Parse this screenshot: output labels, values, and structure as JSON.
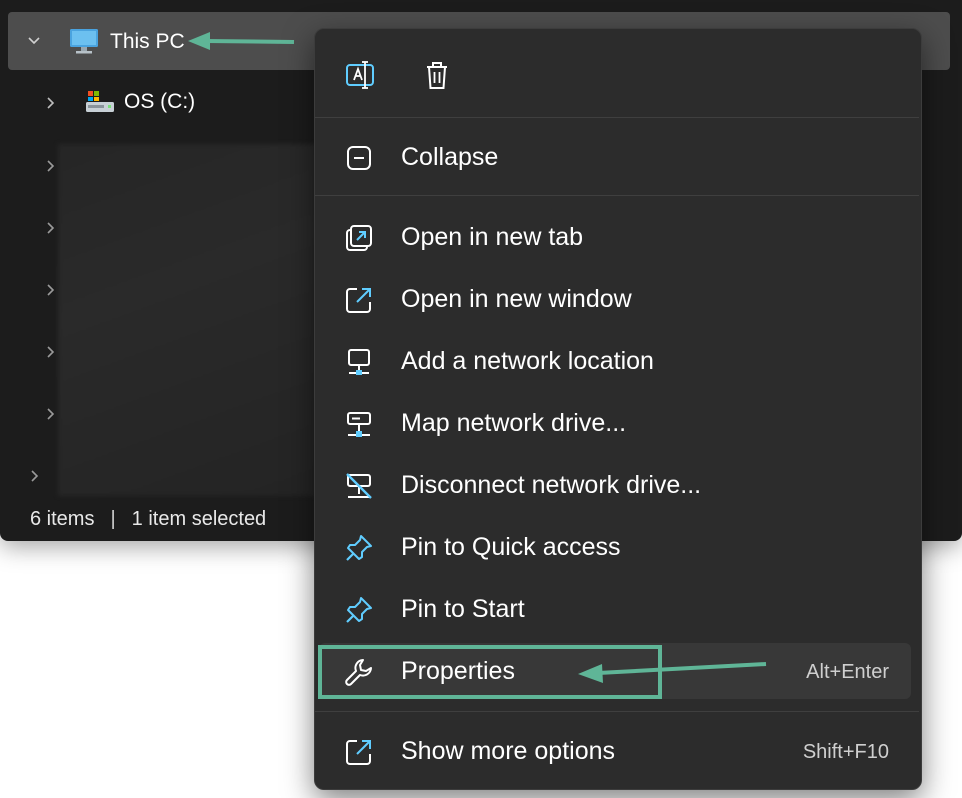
{
  "tree": {
    "this_pc": "This PC",
    "os_drive": "OS (C:)"
  },
  "status": {
    "items": "6 items",
    "selected": "1 item selected"
  },
  "menu": {
    "toolbar": [
      {
        "name": "rename-icon"
      },
      {
        "name": "delete-icon"
      }
    ],
    "collapse": "Collapse",
    "items": [
      {
        "label": "Open in new tab"
      },
      {
        "label": "Open in new window"
      },
      {
        "label": "Add a network location"
      },
      {
        "label": "Map network drive..."
      },
      {
        "label": "Disconnect network drive..."
      },
      {
        "label": "Pin to Quick access"
      },
      {
        "label": "Pin to Start"
      }
    ],
    "properties": {
      "label": "Properties",
      "shortcut": "Alt+Enter"
    },
    "more": {
      "label": "Show more options",
      "shortcut": "Shift+F10"
    }
  },
  "colors": {
    "annotation": "#5fb597",
    "accent_icon": "#60cdff"
  }
}
